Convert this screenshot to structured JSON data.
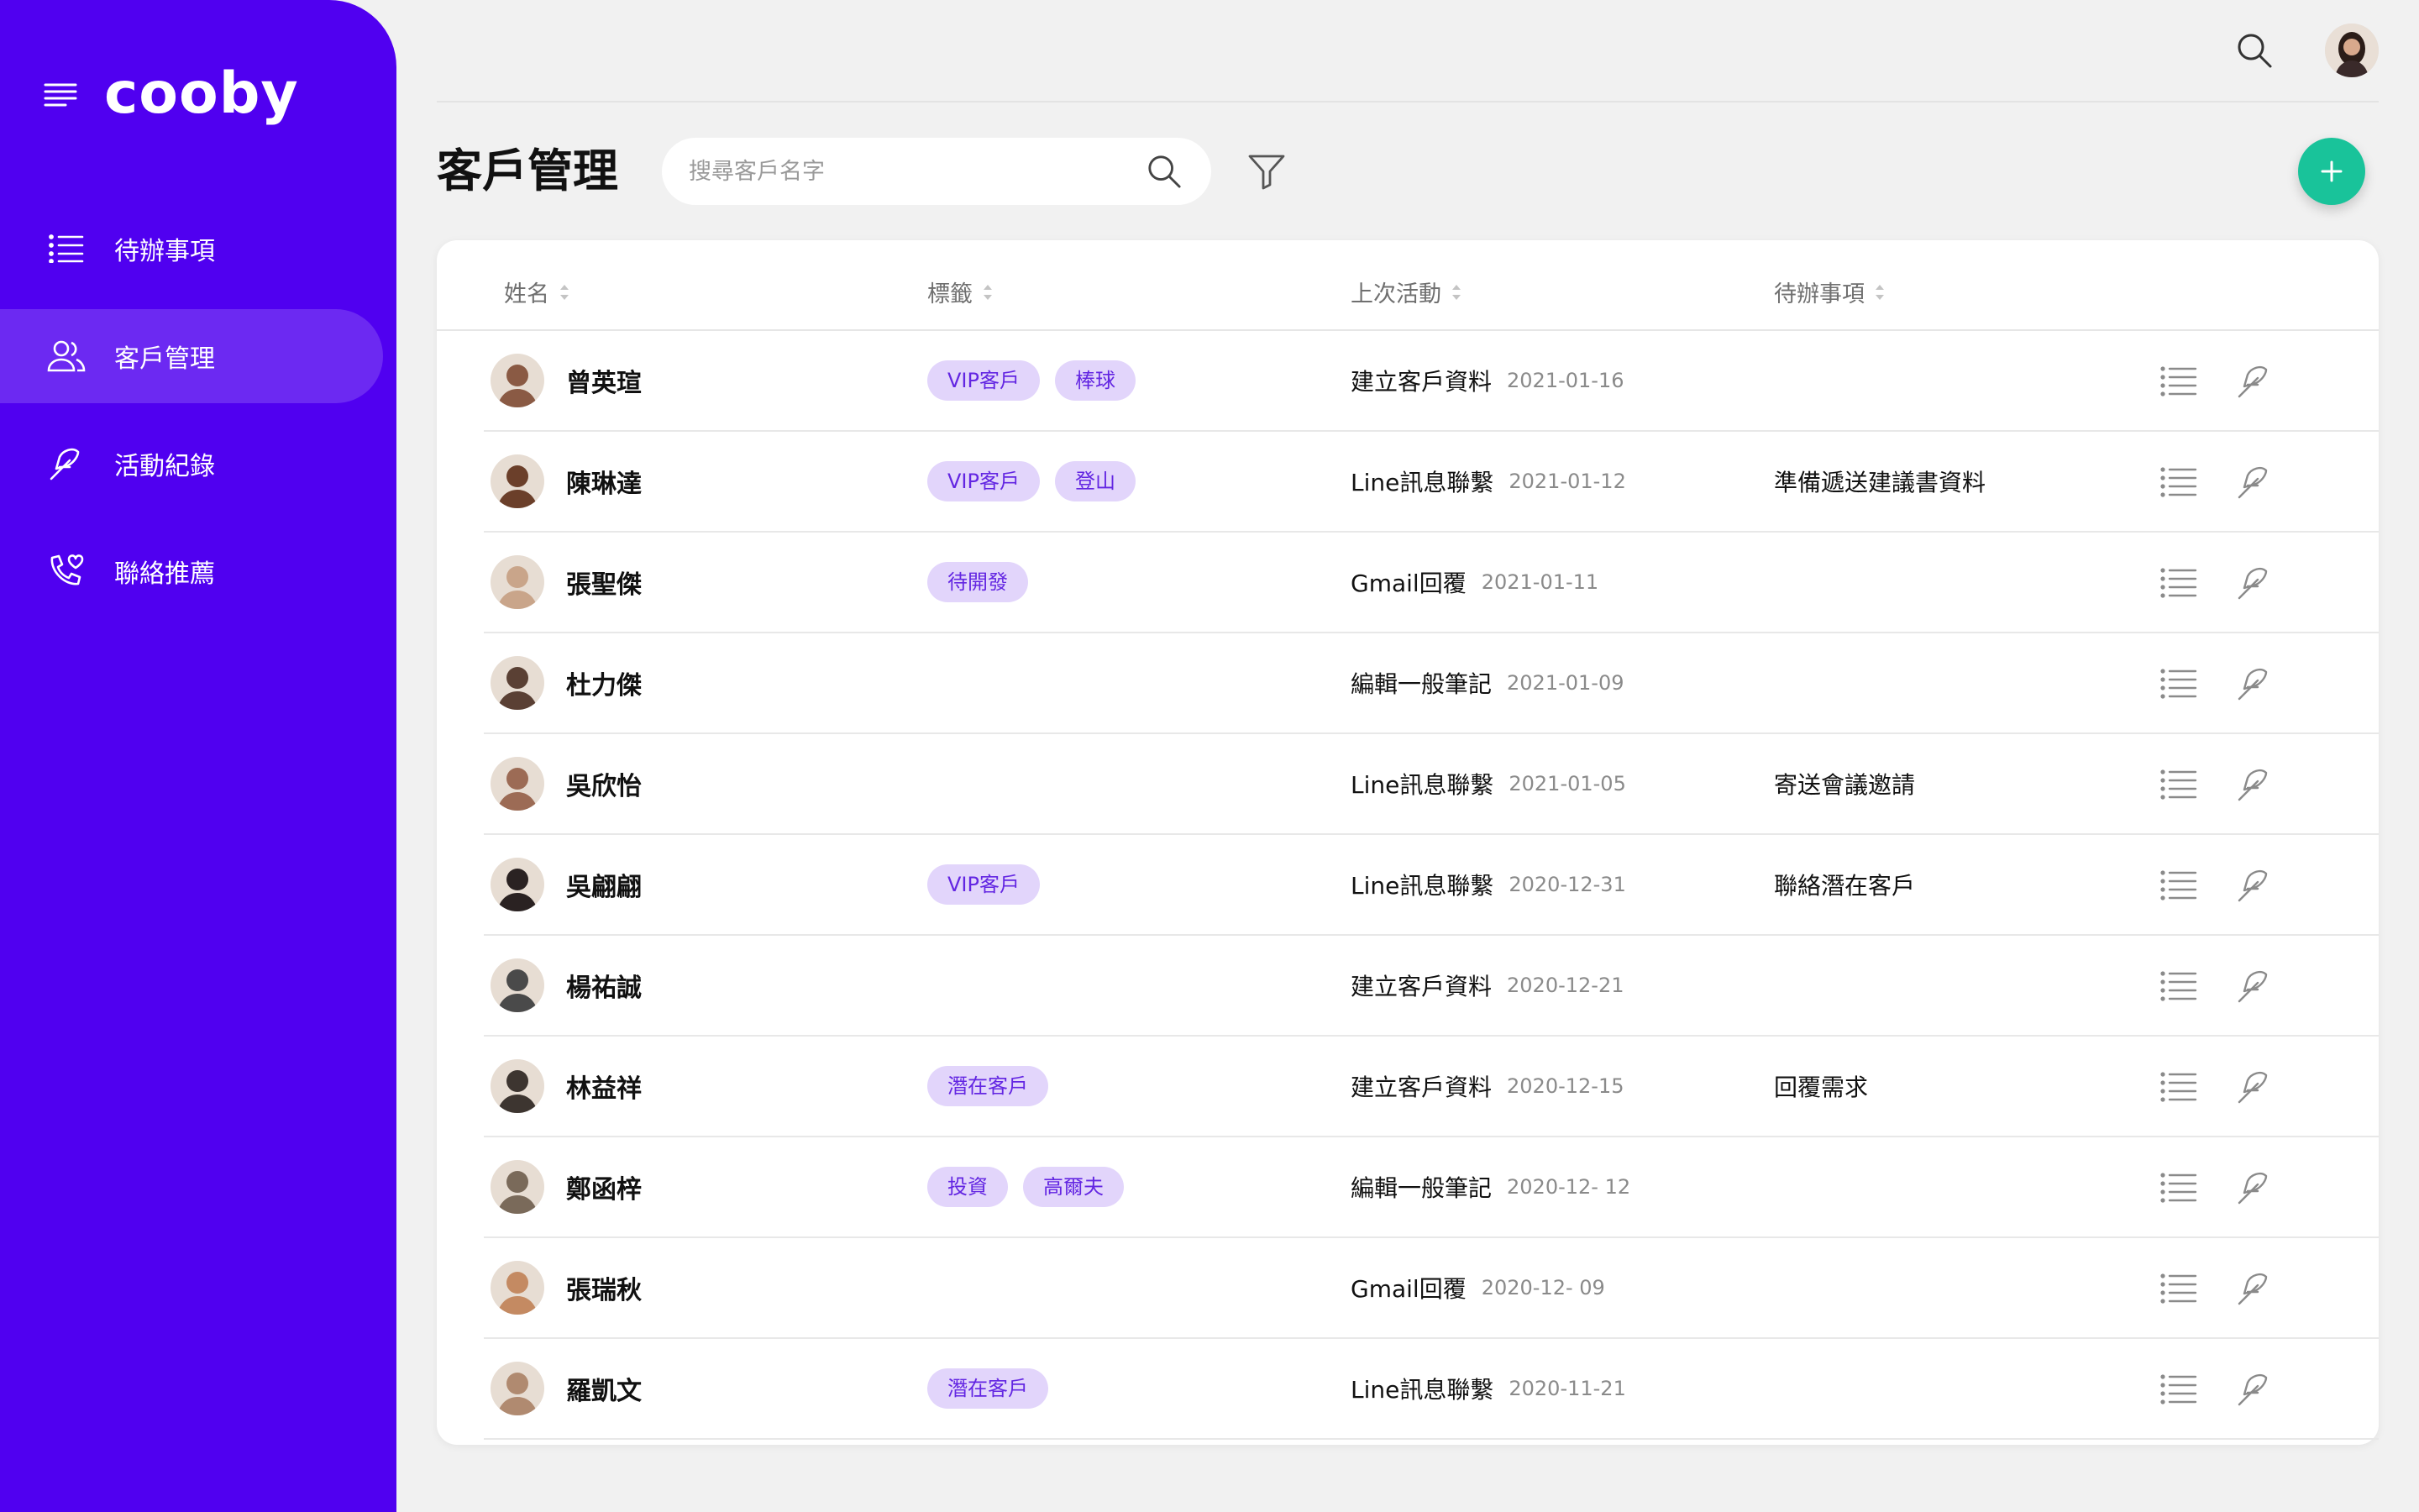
{
  "app": {
    "logo": "cooby"
  },
  "colors": {
    "sidebar": "#5000f0",
    "accent": "#19c39a",
    "tag_bg": "#e2d5fb",
    "tag_text": "#6326e2"
  },
  "sidebar": {
    "items": [
      {
        "label": "待辦事項",
        "icon": "list-icon",
        "active": false
      },
      {
        "label": "客戶管理",
        "icon": "users-icon",
        "active": true
      },
      {
        "label": "活動紀錄",
        "icon": "feather-icon",
        "active": false
      },
      {
        "label": "聯絡推薦",
        "icon": "phone-heart-icon",
        "active": false
      }
    ]
  },
  "header": {
    "title": "客戶管理",
    "search_placeholder": "搜尋客戶名字"
  },
  "table": {
    "columns": [
      "姓名",
      "標籤",
      "上次活動",
      "待辦事項"
    ],
    "rows": [
      {
        "name": "曾英瑄",
        "tags": [
          "VIP客戶",
          "棒球"
        ],
        "activity": "建立客戶資料",
        "date": "2021-01-16",
        "todo": "",
        "avatar_color": "#8a5a44"
      },
      {
        "name": "陳琳達",
        "tags": [
          "VIP客戶",
          "登山"
        ],
        "activity": "Line訊息聯繫",
        "date": "2021-01-12",
        "todo": "準備遞送建議書資料",
        "avatar_color": "#6b3f2a"
      },
      {
        "name": "張聖傑",
        "tags": [
          "待開發"
        ],
        "activity": "Gmail回覆",
        "date": "2021-01-11",
        "todo": "",
        "avatar_color": "#c9a58a"
      },
      {
        "name": "杜力傑",
        "tags": [],
        "activity": "編輯一般筆記",
        "date": "2021-01-09",
        "todo": "",
        "avatar_color": "#5a4034"
      },
      {
        "name": "吳欣怡",
        "tags": [],
        "activity": "Line訊息聯繫",
        "date": "2021-01-05",
        "todo": "寄送會議邀請",
        "avatar_color": "#9c6b55"
      },
      {
        "name": "吳翩翩",
        "tags": [
          "VIP客戶"
        ],
        "activity": "Line訊息聯繫",
        "date": "2020-12-31",
        "todo": "聯絡潛在客戶",
        "avatar_color": "#2a2222"
      },
      {
        "name": "楊祐誠",
        "tags": [],
        "activity": "建立客戶資料",
        "date": "2020-12-21",
        "todo": "",
        "avatar_color": "#4a4a4a"
      },
      {
        "name": "林益祥",
        "tags": [
          "潛在客戶"
        ],
        "activity": "建立客戶資料",
        "date": "2020-12-15",
        "todo": "回覆需求",
        "avatar_color": "#3d3530"
      },
      {
        "name": "鄭函梓",
        "tags": [
          "投資",
          "高爾夫"
        ],
        "activity": "編輯一般筆記",
        "date": "2020-12- 12",
        "todo": "",
        "avatar_color": "#7a6a5a"
      },
      {
        "name": "張瑞秋",
        "tags": [],
        "activity": "Gmail回覆",
        "date": "2020-12- 09",
        "todo": "",
        "avatar_color": "#c48a62"
      },
      {
        "name": "羅凱文",
        "tags": [
          "潛在客戶"
        ],
        "activity": "Line訊息聯繫",
        "date": "2020-11-21",
        "todo": "",
        "avatar_color": "#b08a70"
      }
    ]
  }
}
